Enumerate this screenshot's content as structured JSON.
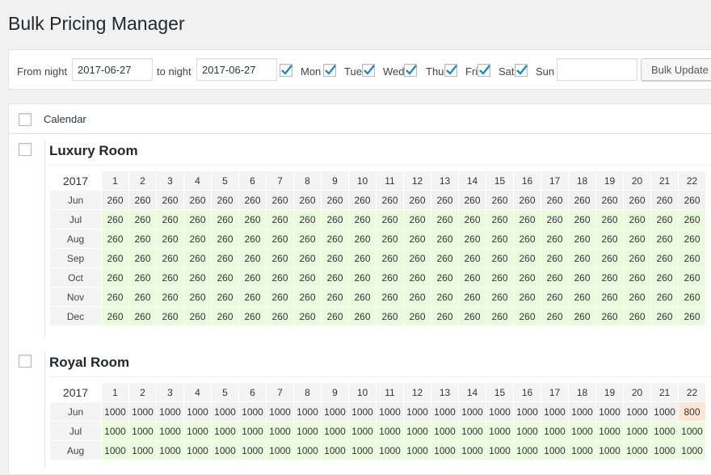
{
  "page_title": "Bulk Pricing Manager",
  "toolbar": {
    "from_label": "From night",
    "from_value": "2017-06-27",
    "to_label": "to night",
    "to_value": "2017-06-27",
    "days": [
      {
        "label": "Mon",
        "checked": true
      },
      {
        "label": "Tue",
        "checked": true
      },
      {
        "label": "Wed",
        "checked": true
      },
      {
        "label": "Thu",
        "checked": true
      },
      {
        "label": "Fri",
        "checked": true
      },
      {
        "label": "Sat",
        "checked": true
      },
      {
        "label": "Sun",
        "checked": true
      }
    ],
    "price_value": "",
    "bulk_update_label": "Bulk Update"
  },
  "list_header": {
    "label": "Calendar"
  },
  "colors": {
    "available": "#eafbe0",
    "past": "#f1f1f1",
    "special": "#fde6d6",
    "check": "#1e8cbe"
  },
  "day_headers": [
    "1",
    "2",
    "3",
    "4",
    "5",
    "6",
    "7",
    "8",
    "9",
    "10",
    "11",
    "12",
    "13",
    "14",
    "15",
    "16",
    "17",
    "18",
    "19",
    "20",
    "21",
    "22"
  ],
  "rooms": [
    {
      "name": "Luxury Room",
      "year": "2017",
      "rows": [
        {
          "month": "Jun",
          "values": [
            "260",
            "260",
            "260",
            "260",
            "260",
            "260",
            "260",
            "260",
            "260",
            "260",
            "260",
            "260",
            "260",
            "260",
            "260",
            "260",
            "260",
            "260",
            "260",
            "260",
            "260",
            "260"
          ],
          "status": "past"
        },
        {
          "month": "Jul",
          "values": [
            "260",
            "260",
            "260",
            "260",
            "260",
            "260",
            "260",
            "260",
            "260",
            "260",
            "260",
            "260",
            "260",
            "260",
            "260",
            "260",
            "260",
            "260",
            "260",
            "260",
            "260",
            "260"
          ]
        },
        {
          "month": "Aug",
          "values": [
            "260",
            "260",
            "260",
            "260",
            "260",
            "260",
            "260",
            "260",
            "260",
            "260",
            "260",
            "260",
            "260",
            "260",
            "260",
            "260",
            "260",
            "260",
            "260",
            "260",
            "260",
            "260"
          ]
        },
        {
          "month": "Sep",
          "values": [
            "260",
            "260",
            "260",
            "260",
            "260",
            "260",
            "260",
            "260",
            "260",
            "260",
            "260",
            "260",
            "260",
            "260",
            "260",
            "260",
            "260",
            "260",
            "260",
            "260",
            "260",
            "260"
          ]
        },
        {
          "month": "Oct",
          "values": [
            "260",
            "260",
            "260",
            "260",
            "260",
            "260",
            "260",
            "260",
            "260",
            "260",
            "260",
            "260",
            "260",
            "260",
            "260",
            "260",
            "260",
            "260",
            "260",
            "260",
            "260",
            "260"
          ]
        },
        {
          "month": "Nov",
          "values": [
            "260",
            "260",
            "260",
            "260",
            "260",
            "260",
            "260",
            "260",
            "260",
            "260",
            "260",
            "260",
            "260",
            "260",
            "260",
            "260",
            "260",
            "260",
            "260",
            "260",
            "260",
            "260"
          ]
        },
        {
          "month": "Dec",
          "values": [
            "260",
            "260",
            "260",
            "260",
            "260",
            "260",
            "260",
            "260",
            "260",
            "260",
            "260",
            "260",
            "260",
            "260",
            "260",
            "260",
            "260",
            "260",
            "260",
            "260",
            "260",
            "260"
          ]
        }
      ]
    },
    {
      "name": "Royal Room",
      "year": "2017",
      "rows": [
        {
          "month": "Jun",
          "values": [
            "1000",
            "1000",
            "1000",
            "1000",
            "1000",
            "1000",
            "1000",
            "1000",
            "1000",
            "1000",
            "1000",
            "1000",
            "1000",
            "1000",
            "1000",
            "1000",
            "1000",
            "1000",
            "1000",
            "1000",
            "1000",
            "800"
          ],
          "status": "past",
          "special_days": [
            22
          ]
        },
        {
          "month": "Jul",
          "values": [
            "1000",
            "1000",
            "1000",
            "1000",
            "1000",
            "1000",
            "1000",
            "1000",
            "1000",
            "1000",
            "1000",
            "1000",
            "1000",
            "1000",
            "1000",
            "1000",
            "1000",
            "1000",
            "1000",
            "1000",
            "1000",
            "1000"
          ]
        },
        {
          "month": "Aug",
          "values": [
            "1000",
            "1000",
            "1000",
            "1000",
            "1000",
            "1000",
            "1000",
            "1000",
            "1000",
            "1000",
            "1000",
            "1000",
            "1000",
            "1000",
            "1000",
            "1000",
            "1000",
            "1000",
            "1000",
            "1000",
            "1000",
            "1000"
          ]
        }
      ]
    }
  ]
}
